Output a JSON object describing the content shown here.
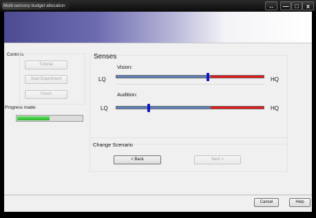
{
  "window": {
    "title": "Multi-sensory budget allocation",
    "resize_glyph": "↔",
    "minimize_glyph": "—",
    "maximize_glyph": "□",
    "close_glyph": "x"
  },
  "controls": {
    "heading": "Controls",
    "tutorial_label": "Tutorial",
    "start_label": "Start Experiment",
    "finish_label": "Finish",
    "progress_label": "Progress made:",
    "progress_value": 0.5
  },
  "senses": {
    "heading": "Senses",
    "low_label": "LQ",
    "high_label": "HQ",
    "items": [
      {
        "name": "Vision:",
        "value": 0.62,
        "boundary": 0.64,
        "track_color": "#5d7fb8",
        "cut_color": "#e01818"
      },
      {
        "name": "Audition:",
        "value": 0.22,
        "boundary": 0.64,
        "track_color": "#5d7fb8",
        "cut_color": "#e01818"
      }
    ]
  },
  "scenario": {
    "heading": "Change Scenario",
    "back_label": "< Back",
    "next_label": "Next >"
  },
  "footer": {
    "cancel_label": "Cancel",
    "help_label": "Help"
  },
  "colors": {
    "accent": "#4c4a92",
    "progress": "#25b625",
    "thumb": "#1414c8"
  }
}
